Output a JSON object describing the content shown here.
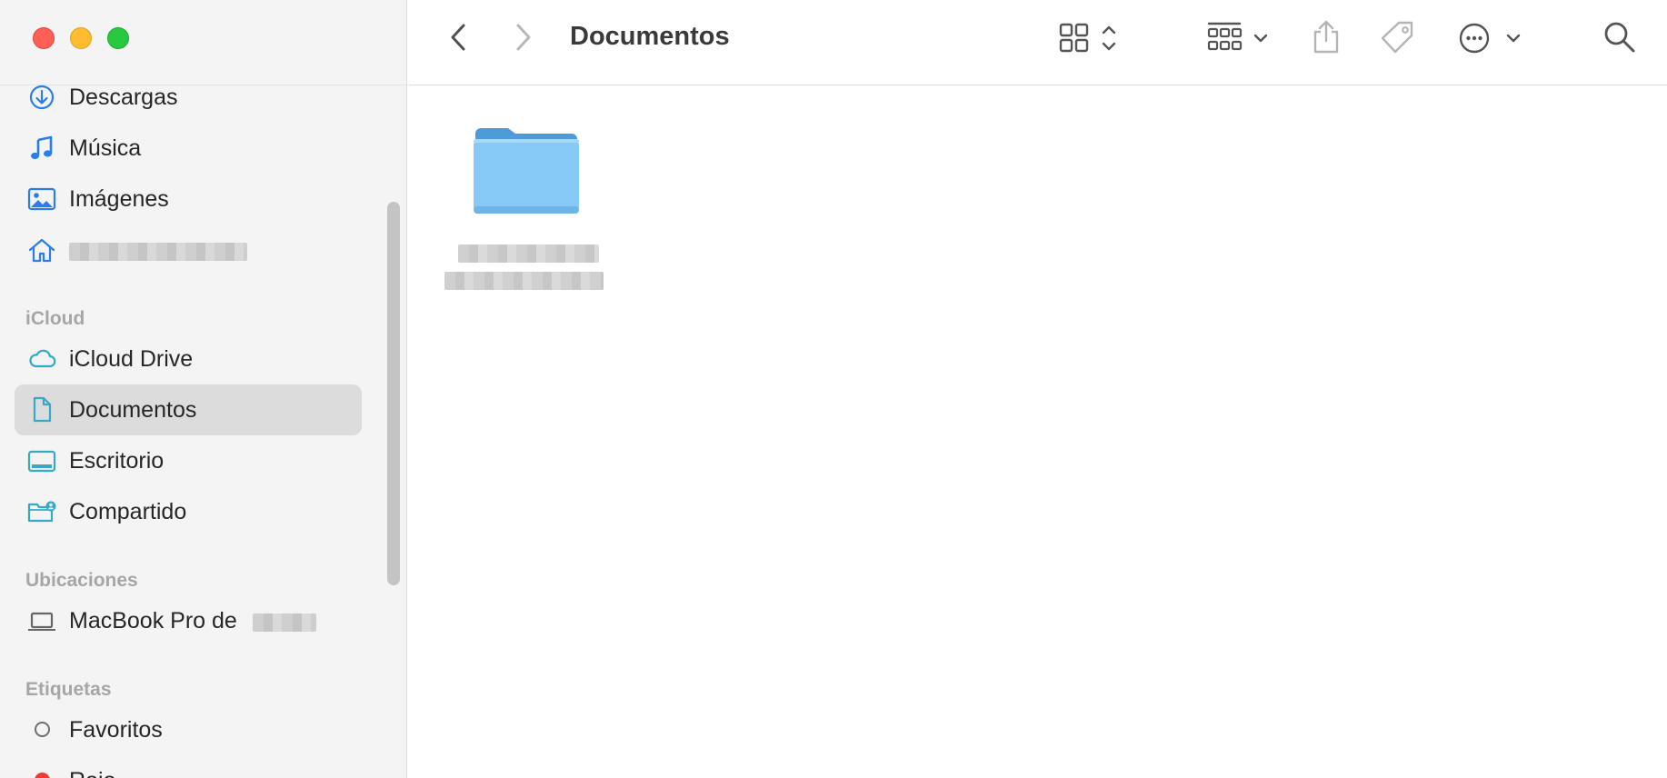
{
  "window": {
    "title": "Documentos"
  },
  "sidebar": {
    "favorites": [
      {
        "label": "Descargas",
        "icon": "download-icon"
      },
      {
        "label": "Música",
        "icon": "music-note-icon"
      },
      {
        "label": "Imágenes",
        "icon": "photo-icon"
      },
      {
        "label": "",
        "icon": "home-icon",
        "redacted": true
      }
    ],
    "icloud_header": "iCloud",
    "icloud": [
      {
        "label": "iCloud Drive",
        "icon": "cloud-icon"
      },
      {
        "label": "Documentos",
        "icon": "document-icon",
        "selected": true
      },
      {
        "label": "Escritorio",
        "icon": "desktop-icon"
      },
      {
        "label": "Compartido",
        "icon": "shared-folder-icon"
      }
    ],
    "locations_header": "Ubicaciones",
    "locations": [
      {
        "label": "MacBook Pro de",
        "icon": "laptop-icon",
        "suffix_redacted": true
      }
    ],
    "tags_header": "Etiquetas",
    "tags": [
      {
        "label": "Favoritos",
        "color": "#6f6f6f"
      },
      {
        "label": "Rojo",
        "color": "#ee3b34"
      }
    ]
  },
  "toolbar": {
    "buttons": [
      "back-icon",
      "forward-icon",
      "icon-view-icon",
      "group-icon",
      "share-icon",
      "tag-icon",
      "more-icon",
      "search-icon"
    ]
  },
  "content": {
    "items": [
      {
        "type": "folder",
        "name_redacted": true,
        "color": "#86c9f6"
      }
    ]
  },
  "colors": {
    "accent": "#2b7de9",
    "sidebar_bg": "#f4f4f4",
    "selected_bg": "#dcdcdc",
    "folder": "#86c9f6"
  }
}
